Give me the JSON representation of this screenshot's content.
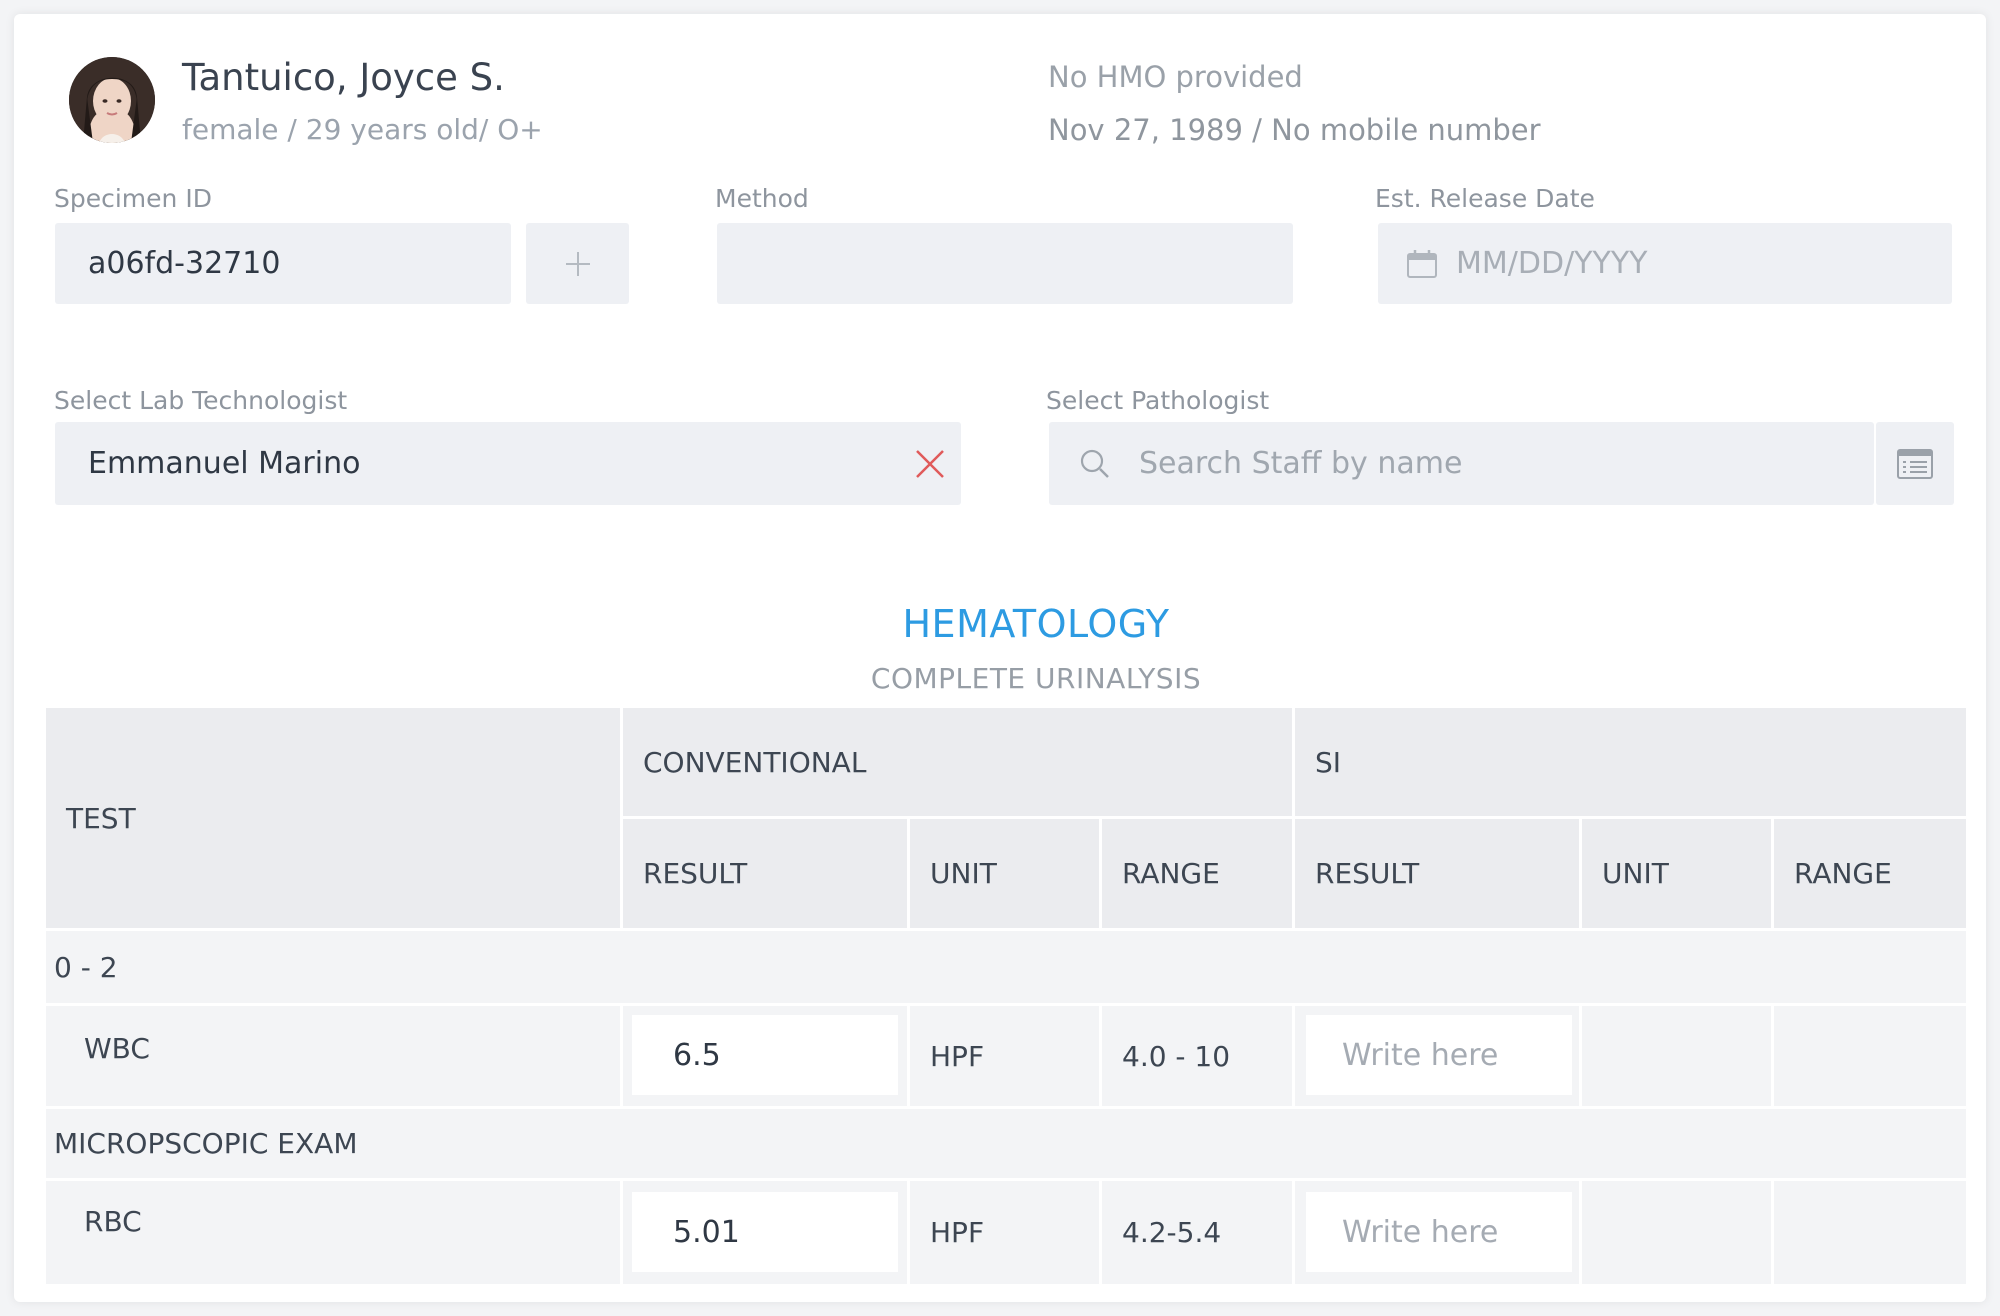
{
  "patient": {
    "name": "Tantuico, Joyce S.",
    "meta": "female / 29 years old/ O+",
    "hmo": "No HMO provided",
    "dob_mobile": "Nov 27, 1989 / No mobile number"
  },
  "specimen": {
    "label": "Specimen ID",
    "value": "a06fd-32710",
    "add_icon": "plus-icon"
  },
  "method": {
    "label": "Method",
    "value": ""
  },
  "release_date": {
    "label": "Est. Release Date",
    "placeholder": "MM/DD/YYYY",
    "icon": "calendar-icon"
  },
  "lab_technologist": {
    "label": "Select Lab Technologist",
    "value": "Emmanuel Marino",
    "clear_icon": "close-icon",
    "clear_color": "#e05a5a"
  },
  "pathologist": {
    "label": "Select Pathologist",
    "placeholder": "Search Staff by name",
    "search_icon": "search-icon",
    "list_icon": "list-icon"
  },
  "section": {
    "title": "HEMATOLOGY",
    "subtitle": "COMPLETE URINALYSIS",
    "title_color": "#2d9be2"
  },
  "table": {
    "headers": {
      "test": "TEST",
      "conventional": "CONVENTIONAL",
      "si": "SI",
      "result": "RESULT",
      "unit": "UNIT",
      "range": "RANGE"
    },
    "groups": [
      {
        "label": "0 - 2",
        "rows": [
          {
            "test": "WBC",
            "conv_result": "6.5",
            "conv_unit": "HPF",
            "conv_range": "4.0 - 10",
            "si_result_placeholder": "Write here",
            "si_unit": "",
            "si_range": ""
          }
        ]
      },
      {
        "label": "MICROPSCOPIC EXAM",
        "rows": [
          {
            "test": "RBC",
            "conv_result": "5.01",
            "conv_unit": "HPF",
            "conv_range": "4.2-5.4",
            "si_result_placeholder": "Write here",
            "si_unit": "",
            "si_range": ""
          }
        ]
      }
    ]
  }
}
